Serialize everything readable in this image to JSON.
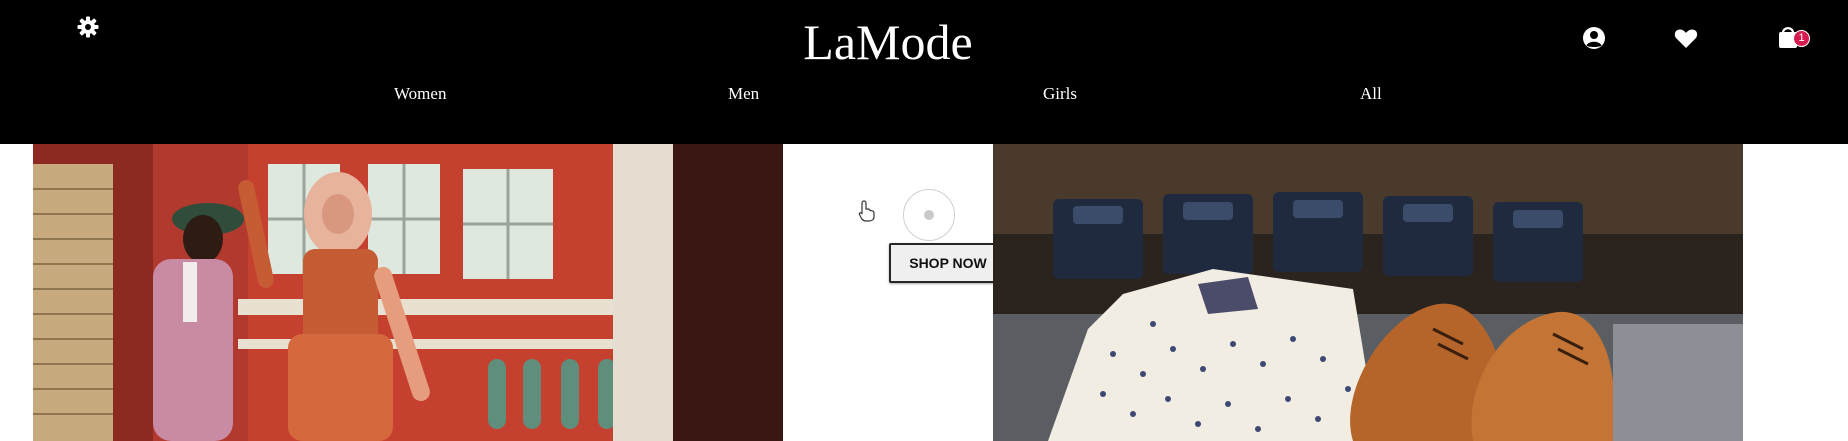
{
  "header": {
    "logo": "LaMode",
    "cart_count": "1"
  },
  "nav": {
    "items": [
      {
        "label": "Women"
      },
      {
        "label": "Men"
      },
      {
        "label": "Girls"
      },
      {
        "label": "All"
      }
    ]
  },
  "hero": {
    "shop_now": "SHOP NOW"
  },
  "icons": {
    "settings": "gear-icon",
    "account": "user-circle-icon",
    "wishlist": "heart-icon",
    "cart": "shopping-bag-icon",
    "pointer": "hand-pointer-icon"
  },
  "colors": {
    "header_bg": "#000000",
    "header_text": "#ffffff",
    "badge": "#d81b4f",
    "button_bg": "#efefef"
  }
}
